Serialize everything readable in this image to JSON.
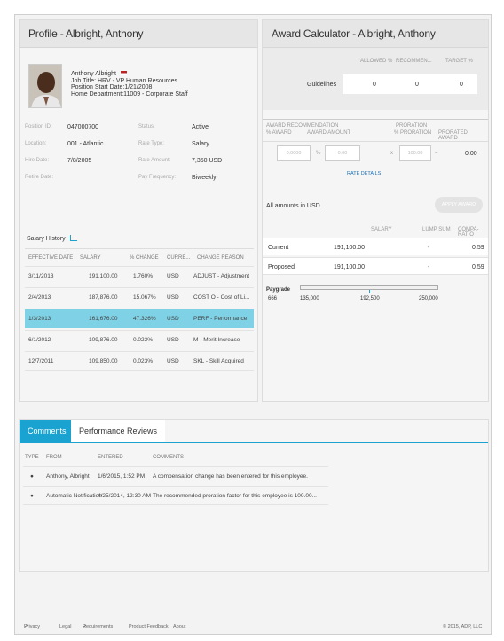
{
  "profile": {
    "title": "Profile - Albright, Anthony",
    "name": "Anthony Albright",
    "job_title_label": "Job Title:",
    "job_title": "HRV - VP Human Resources",
    "position_start_label": "Position Start Date:",
    "position_start": "1/21/2008",
    "home_dept_label": "Home Department:",
    "home_dept": "11009 - Corporate Staff",
    "fields_left": [
      {
        "label": "Position ID:",
        "value": "047000700"
      },
      {
        "label": "Location:",
        "value": "001 - Atlantic"
      },
      {
        "label": "Hire Date:",
        "value": "7/8/2005"
      },
      {
        "label": "Retire Date:",
        "value": ""
      }
    ],
    "fields_right": [
      {
        "label": "Status:",
        "value": "Active"
      },
      {
        "label": "Rate Type:",
        "value": "Salary"
      },
      {
        "label": "Rate Amount:",
        "value": "7,350 USD"
      },
      {
        "label": "Pay Frequency:",
        "value": "Biweekly"
      }
    ],
    "salary_history_label": "Salary History",
    "salary_columns": [
      "EFFECTIVE DATE",
      "SALARY",
      "% CHANGE",
      "CURRE...",
      "CHANGE REASON"
    ],
    "salary_rows": [
      [
        "3/11/2013",
        "191,100.00",
        "1.760%",
        "USD",
        "ADJUST - Adjustment"
      ],
      [
        "2/4/2013",
        "187,876.00",
        "15.067%",
        "USD",
        "COST O - Cost of Li..."
      ],
      [
        "1/3/2013",
        "161,676.00",
        "47.326%",
        "USD",
        "PERF - Performance"
      ],
      [
        "6/1/2012",
        "109,876.00",
        "0.023%",
        "USD",
        "M - Merit Increase"
      ],
      [
        "12/7/2011",
        "109,850.00",
        "0.023%",
        "USD",
        "SKL - Skill Acquired"
      ]
    ],
    "selected_row": 2
  },
  "award": {
    "title": "Award Calculator - Albright, Anthony",
    "guide_columns": [
      "ALLOWED %",
      "RECOMMEN...",
      "TARGET %"
    ],
    "guidelines_label": "Guidelines",
    "guide_values": [
      "0",
      "0",
      "0"
    ],
    "rec_header": "AWARD RECOMMENDATION",
    "rec_cols": [
      "% AWARD",
      "AWARD AMOUNT"
    ],
    "proration_header": "PRORATION",
    "proration_cols": [
      "% PRORATION",
      "PRORATED AWARD"
    ],
    "award_pct": "0.0000",
    "award_amt": "0.00",
    "proration_pct": "100.00",
    "prorated_award": "0.00",
    "rate_details": "RATE DETAILS",
    "amounts_note": "All amounts in USD.",
    "apply_btn": "APPLY AWARD",
    "summary_cols": [
      "SALARY",
      "LUMP SUM",
      "COMPA-RATIO"
    ],
    "summary_rows": [
      {
        "label": "Current",
        "salary": "191,100.00",
        "lump": "-",
        "compa": "0.59"
      },
      {
        "label": "Proposed",
        "salary": "191,100.00",
        "lump": "-",
        "compa": "0.59"
      }
    ],
    "paygrade_label": "Paygrade",
    "paygrade_code": "666",
    "paygrade_min": "135,000",
    "paygrade_mid": "192,500",
    "paygrade_max": "250,000"
  },
  "bottom": {
    "tabs": [
      "Comments",
      "Performance Reviews"
    ],
    "active_tab": 0,
    "columns": [
      "TYPE",
      "FROM",
      "ENTERED",
      "COMMENTS"
    ],
    "rows": [
      {
        "from": "Anthony, Albright",
        "entered": "1/6/2015, 1:52 PM",
        "comment": "A compensation change has been entered for this employee."
      },
      {
        "from": "Automatic Notification",
        "entered": "4/25/2014, 12:30 AM",
        "comment": "The recommended proration factor for this employee is 100.00..."
      }
    ]
  },
  "footer": {
    "links": [
      "Privacy",
      "Legal",
      "Requirements",
      "Product Feedback",
      "About"
    ],
    "copyright": "© 2015, ADP, LLC"
  },
  "colors": {
    "accent": "#1aa3d1",
    "selected": "#7fd2e6"
  }
}
